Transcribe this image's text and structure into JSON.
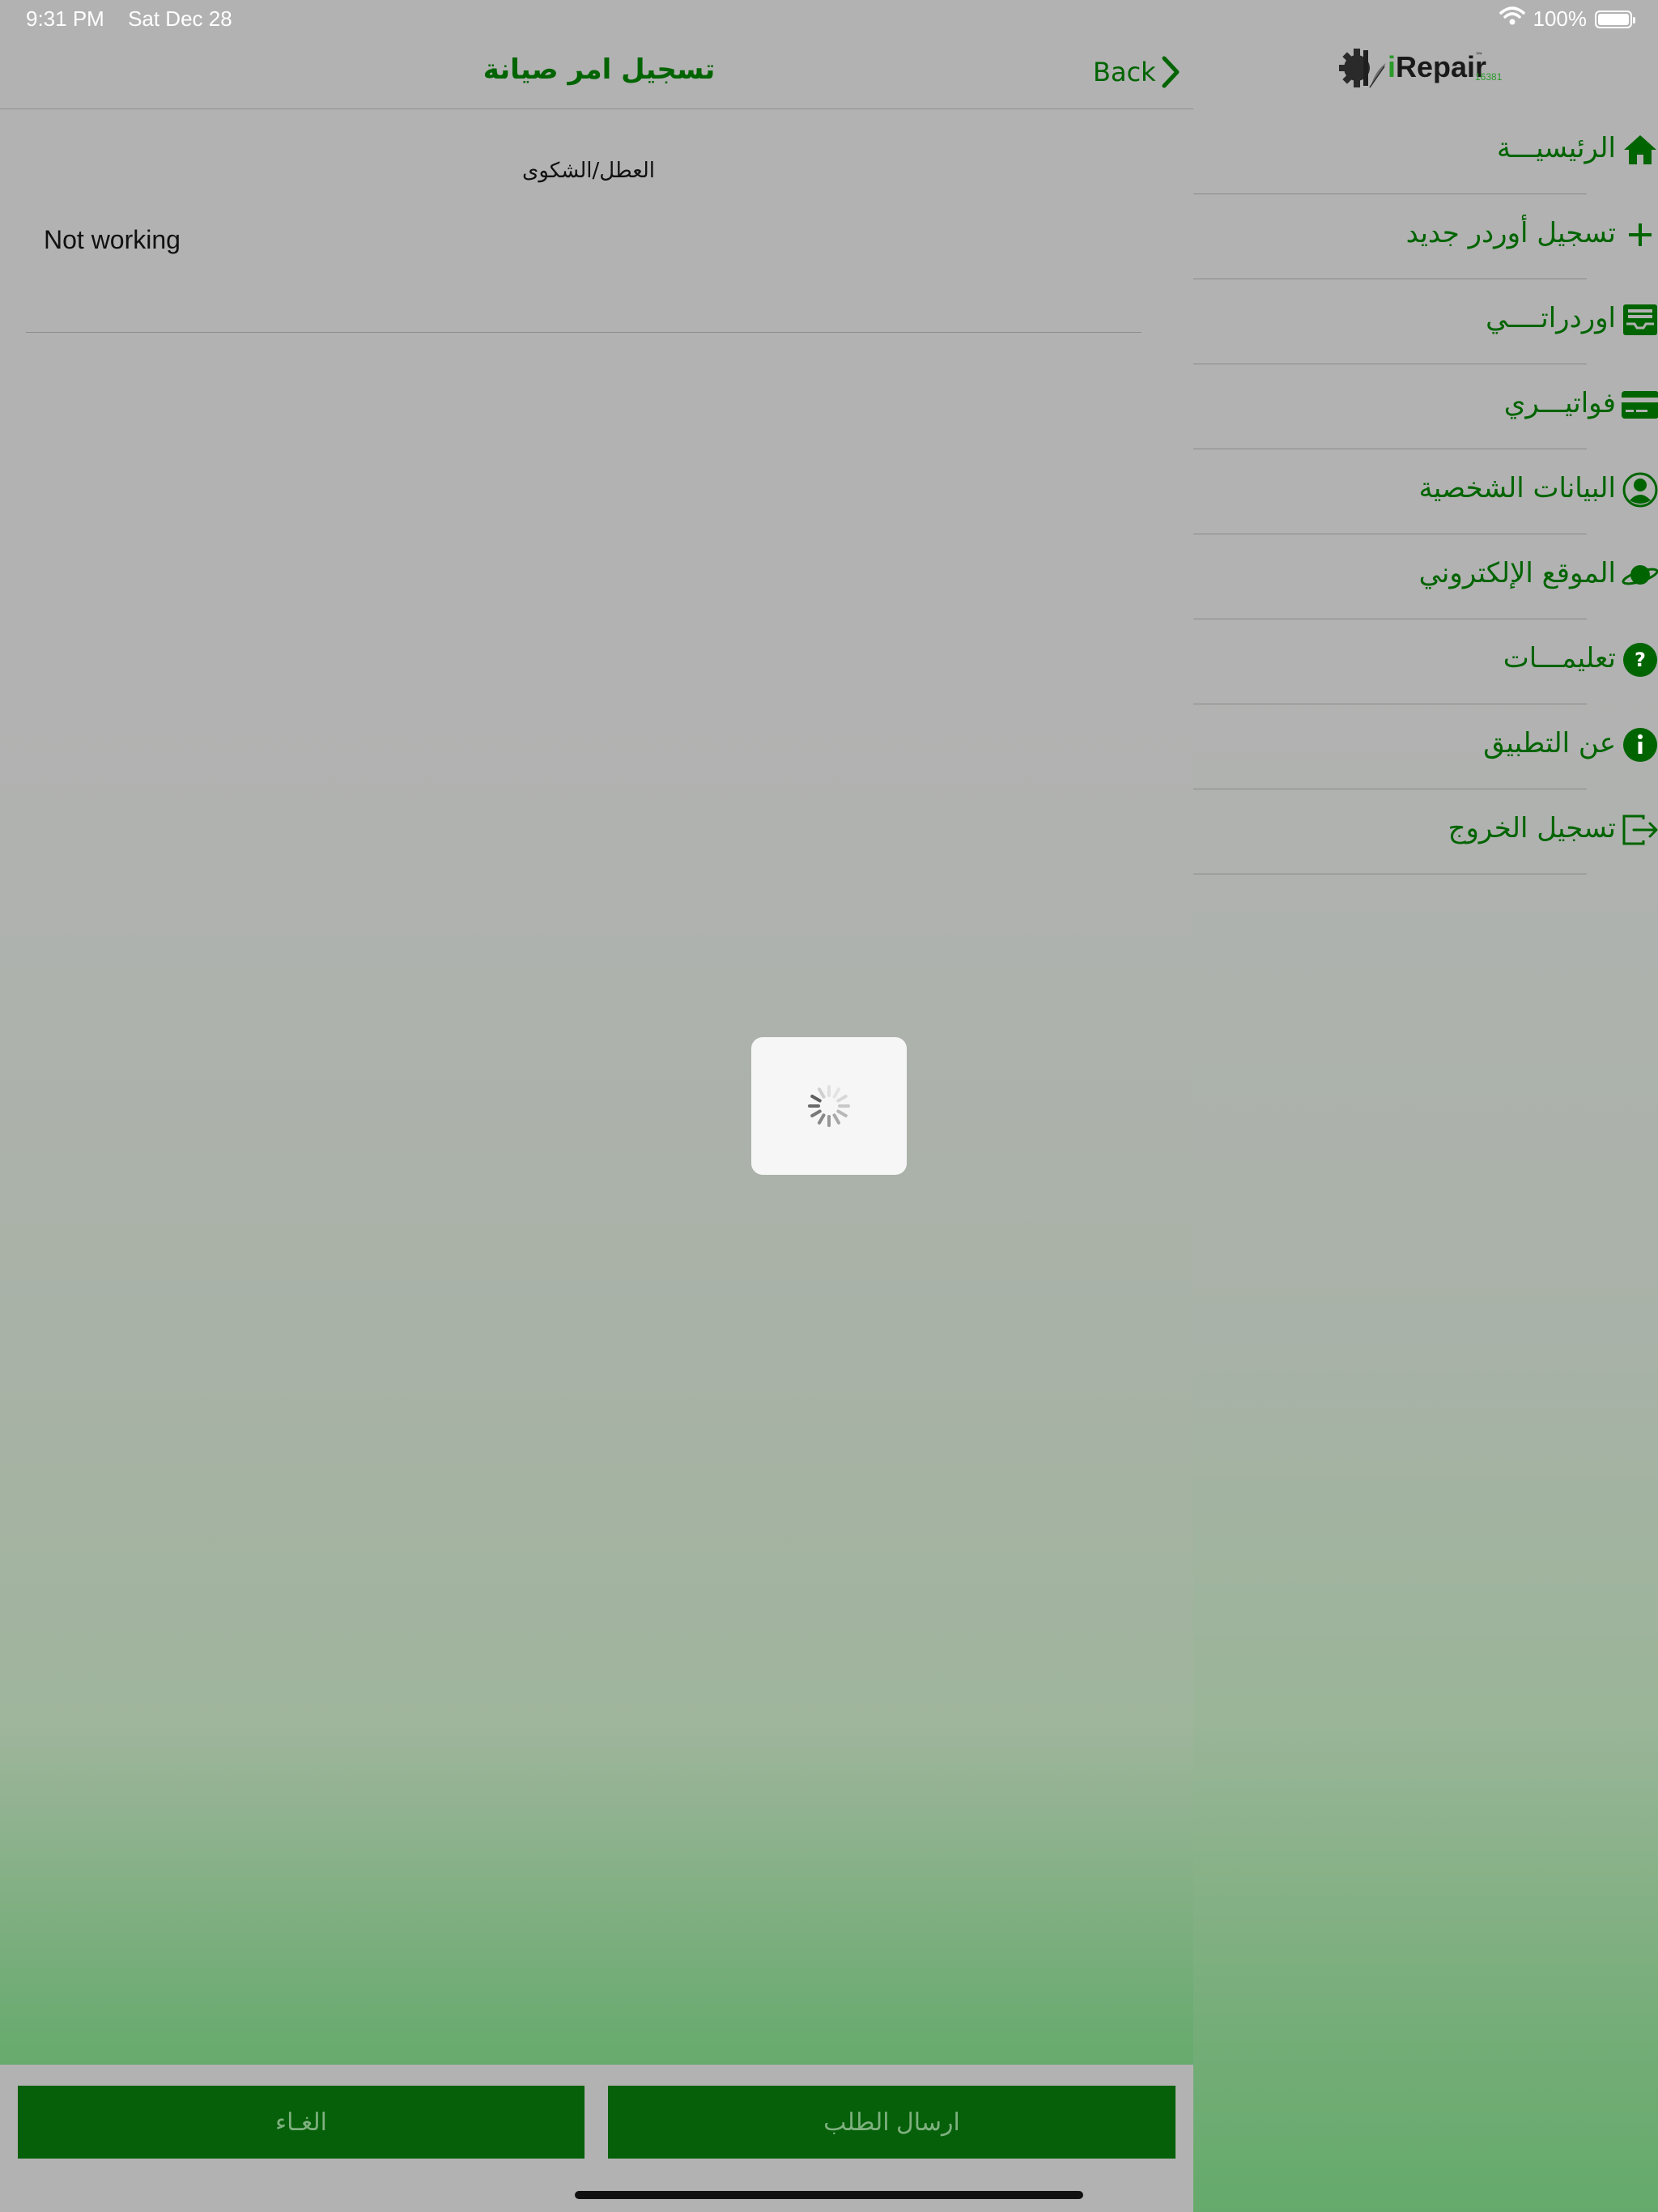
{
  "status_bar": {
    "time": "9:31 PM",
    "date": "Sat Dec 28",
    "battery": "100%"
  },
  "header": {
    "title": "تسجيل امر صيانة",
    "back_label": "Back"
  },
  "form": {
    "complaint_label": "العطل/الشكوى",
    "complaint_value": "Not working"
  },
  "buttons": {
    "cancel_label": "الغـاء",
    "submit_label": "ارسال الطلب"
  },
  "logo": {
    "brand": "Repair",
    "brand_prefix": "i",
    "tm": "™",
    "number": "16381"
  },
  "menu": {
    "items": [
      {
        "label": "الرئيسيـــة",
        "icon": "home-icon"
      },
      {
        "label": "تسجيل أوردر جديد",
        "icon": "plus-icon"
      },
      {
        "label": "اوردراتــــي",
        "icon": "inbox-icon"
      },
      {
        "label": "فواتيـــري",
        "icon": "credit-card-icon"
      },
      {
        "label": "البيانات الشخصية",
        "icon": "user-circle-icon"
      },
      {
        "label": "الموقع الإلكتروني",
        "icon": "planet-icon"
      },
      {
        "label": "تعليمـــات",
        "icon": "question-icon"
      },
      {
        "label": "عن التطبيق",
        "icon": "info-icon"
      },
      {
        "label": "تسجيل الخروج",
        "icon": "logout-icon"
      }
    ]
  },
  "colors": {
    "accent": "#006400",
    "button_bg": "#056009",
    "button_text": "#7fb07f"
  }
}
